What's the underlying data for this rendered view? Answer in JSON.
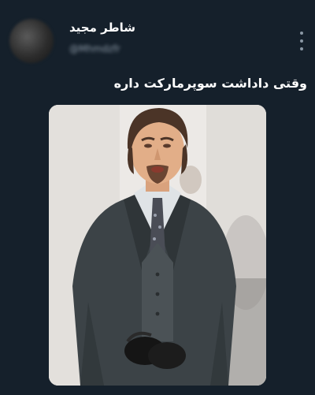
{
  "tweet": {
    "display_name": "شاطر مجید",
    "handle": "@Mhmdzfr",
    "text": "وقتی داداشت سوپرمارکت داره",
    "more_icon": "more-vertical-icon",
    "media_description_icon": "meme-photo"
  }
}
